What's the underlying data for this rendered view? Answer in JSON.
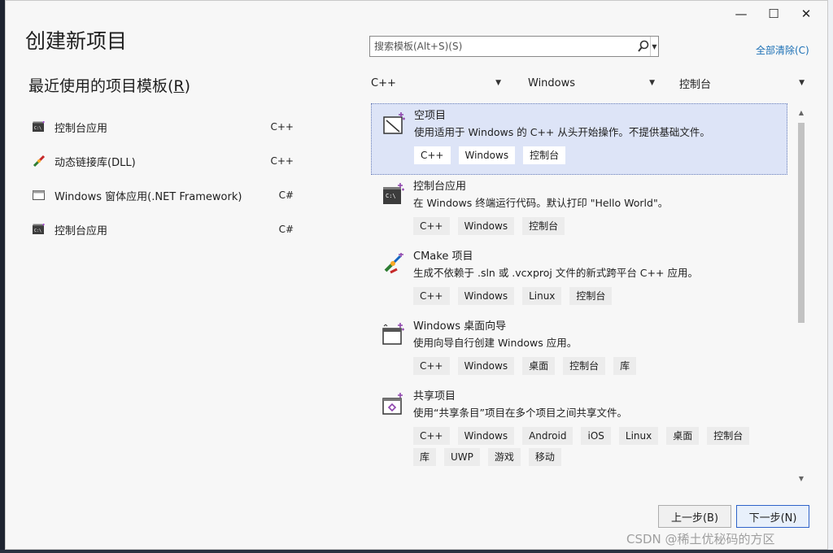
{
  "window": {
    "title": "创建新项目",
    "minimize_glyph": "—",
    "maximize_glyph": "☐",
    "close_glyph": "✕"
  },
  "recent": {
    "title_prefix": "最近使用的项目模板(",
    "title_hotkey": "R",
    "title_suffix": ")",
    "items": [
      {
        "label": "控制台应用",
        "lang": "C++",
        "icon": "console-app-icon"
      },
      {
        "label": "动态链接库(DLL)",
        "lang": "C++",
        "icon": "dll-icon"
      },
      {
        "label": "Windows 窗体应用(.NET Framework)",
        "lang": "C#",
        "icon": "windows-form-icon"
      },
      {
        "label": "控制台应用",
        "lang": "C#",
        "icon": "console-app-icon"
      }
    ]
  },
  "search": {
    "placeholder": "搜索模板(Alt+S)(S)",
    "icon": "search-icon"
  },
  "clear_all": "全部清除(C)",
  "filters": {
    "language": "C++",
    "platform": "Windows",
    "project_type": "控制台"
  },
  "templates": [
    {
      "name": "空项目",
      "desc": "使用适用于 Windows 的 C++ 从头开始操作。不提供基础文件。",
      "tags": [
        "C++",
        "Windows",
        "控制台"
      ],
      "selected": true,
      "icon": "empty-project-icon"
    },
    {
      "name": "控制台应用",
      "desc": "在 Windows 终端运行代码。默认打印 \"Hello World\"。",
      "tags": [
        "C++",
        "Windows",
        "控制台"
      ],
      "selected": false,
      "icon": "console-app-icon"
    },
    {
      "name": "CMake 项目",
      "desc": "生成不依赖于 .sln 或 .vcxproj 文件的新式跨平台 C++ 应用。",
      "tags": [
        "C++",
        "Windows",
        "Linux",
        "控制台"
      ],
      "selected": false,
      "icon": "cmake-icon"
    },
    {
      "name": "Windows 桌面向导",
      "desc": "使用向导自行创建 Windows 应用。",
      "tags": [
        "C++",
        "Windows",
        "桌面",
        "控制台",
        "库"
      ],
      "selected": false,
      "icon": "desktop-wizard-icon"
    },
    {
      "name": "共享项目",
      "desc": "使用“共享条目”项目在多个项目之间共享文件。",
      "tags": [
        "C++",
        "Windows",
        "Android",
        "iOS",
        "Linux",
        "桌面",
        "控制台",
        "库",
        "UWP",
        "游戏",
        "移动"
      ],
      "selected": false,
      "icon": "shared-project-icon"
    }
  ],
  "buttons": {
    "back": "上一步(B)",
    "next": "下一步(N)"
  },
  "watermark": "CSDN @稀土优秘码的方区",
  "colors": {
    "accent": "#1a6fb5",
    "selected_bg": "#dde4f7",
    "primary_border": "#2f63c9"
  }
}
